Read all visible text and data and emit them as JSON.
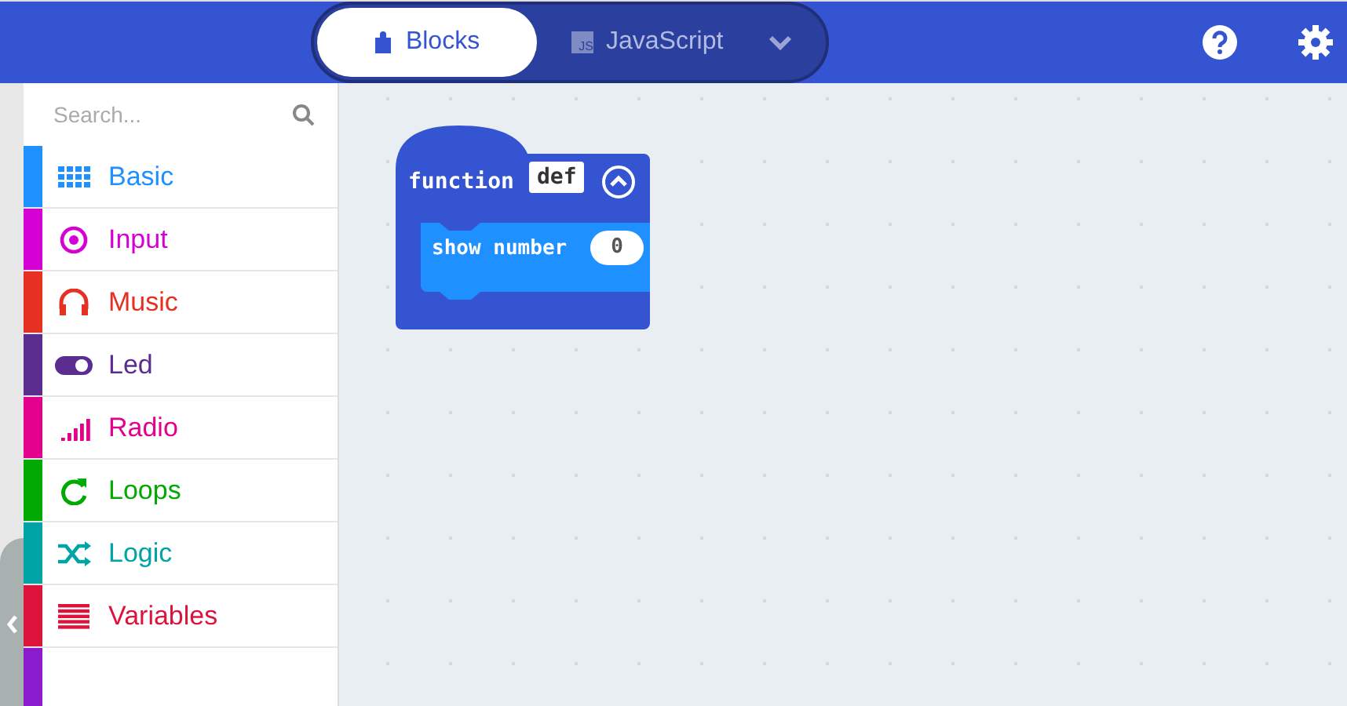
{
  "header": {
    "tabs": [
      {
        "label": "Blocks",
        "selected": true
      },
      {
        "label": "JavaScript",
        "badge": "JS",
        "selected": false
      }
    ]
  },
  "toolbox": {
    "search": {
      "placeholder": "Search..."
    },
    "categories": [
      {
        "label": "Basic",
        "color": "#1e90ff"
      },
      {
        "label": "Input",
        "color": "#d400d4"
      },
      {
        "label": "Music",
        "color": "#e63022"
      },
      {
        "label": "Led",
        "color": "#5c2d91"
      },
      {
        "label": "Radio",
        "color": "#e3008c"
      },
      {
        "label": "Loops",
        "color": "#00aa00"
      },
      {
        "label": "Logic",
        "color": "#00a4a6"
      },
      {
        "label": "Variables",
        "color": "#dc143c"
      },
      {
        "color": "#8a1cce"
      }
    ]
  },
  "workspace": {
    "function_block": {
      "keyword": "function",
      "name": "def",
      "statement": {
        "label": "show number",
        "value": "0"
      }
    }
  }
}
